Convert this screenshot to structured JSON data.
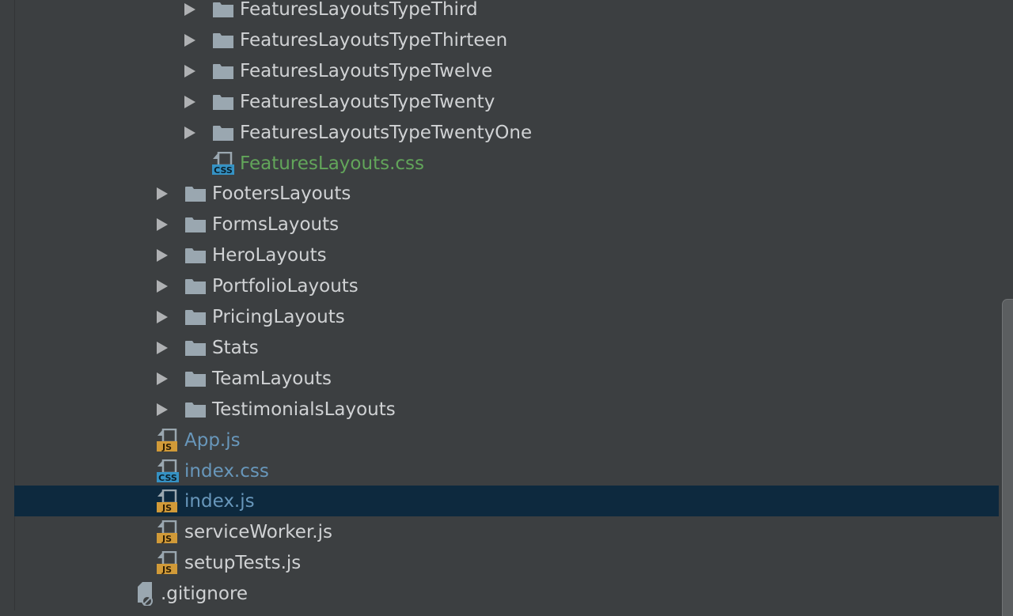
{
  "colors": {
    "background": "#3c3f41",
    "selection": "#0d293e",
    "folder_text": "#d0d2d4",
    "modified_text": "#6897bb",
    "added_text": "#62a55a",
    "arrow": "#afb1b3",
    "folder_icon": "#9aa7b0",
    "js_badge": "#d19a38",
    "css_badge": "#3592c4"
  },
  "project_tree": {
    "items": [
      {
        "label": "FeaturesLayoutsTypeThird",
        "kind": "folder",
        "depth": 2
      },
      {
        "label": "FeaturesLayoutsTypeThirteen",
        "kind": "folder",
        "depth": 2
      },
      {
        "label": "FeaturesLayoutsTypeTwelve",
        "kind": "folder",
        "depth": 2
      },
      {
        "label": "FeaturesLayoutsTypeTwenty",
        "kind": "folder",
        "depth": 2
      },
      {
        "label": "FeaturesLayoutsTypeTwentyOne",
        "kind": "folder",
        "depth": 2
      },
      {
        "label": "FeaturesLayouts.css",
        "kind": "css",
        "badge": "CSS",
        "status": "added",
        "depth": 2
      },
      {
        "label": "FootersLayouts",
        "kind": "folder",
        "depth": 1
      },
      {
        "label": "FormsLayouts",
        "kind": "folder",
        "depth": 1
      },
      {
        "label": "HeroLayouts",
        "kind": "folder",
        "depth": 1
      },
      {
        "label": "PortfolioLayouts",
        "kind": "folder",
        "depth": 1
      },
      {
        "label": "PricingLayouts",
        "kind": "folder",
        "depth": 1
      },
      {
        "label": "Stats",
        "kind": "folder",
        "depth": 1
      },
      {
        "label": "TeamLayouts",
        "kind": "folder",
        "depth": 1
      },
      {
        "label": "TestimonialsLayouts",
        "kind": "folder",
        "depth": 1
      },
      {
        "label": "App.js",
        "kind": "js",
        "badge": "JS",
        "status": "modified",
        "depth": 0
      },
      {
        "label": "index.css",
        "kind": "css",
        "badge": "CSS",
        "status": "modified",
        "depth": 0
      },
      {
        "label": "index.js",
        "kind": "js",
        "badge": "JS",
        "status": "modified",
        "selected": true,
        "depth": 0
      },
      {
        "label": "serviceWorker.js",
        "kind": "js",
        "badge": "JS",
        "depth": 0
      },
      {
        "label": "setupTests.js",
        "kind": "js",
        "badge": "JS",
        "depth": 0
      },
      {
        "label": ".gitignore",
        "kind": "ignore",
        "depth": -1
      }
    ]
  }
}
